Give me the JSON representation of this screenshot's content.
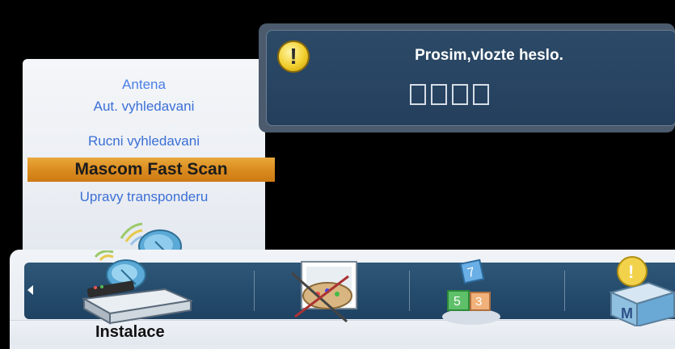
{
  "menu": {
    "items": [
      {
        "label": "Antena"
      },
      {
        "label": "Aut. vyhledavani"
      },
      {
        "label": "Rucni vyhledavani"
      },
      {
        "label": "Mascom Fast Scan",
        "selected": true
      },
      {
        "label": "Upravy transponderu"
      }
    ]
  },
  "dialog": {
    "icon": "warning-icon",
    "message": "Prosim,vlozte heslo.",
    "pin_length": 4
  },
  "categories": {
    "items": [
      {
        "icon": "installation-icon",
        "selected": true
      },
      {
        "icon": "preferences-icon"
      },
      {
        "icon": "system-blocks-icon"
      },
      {
        "icon": "info-box-icon"
      }
    ],
    "current_label": "Instalace"
  },
  "colors": {
    "menu_text": "#3b6fd6",
    "selected_bg": "#d98a1e",
    "dialog_bg": "#284563",
    "bar_bg": "#244a6b"
  }
}
